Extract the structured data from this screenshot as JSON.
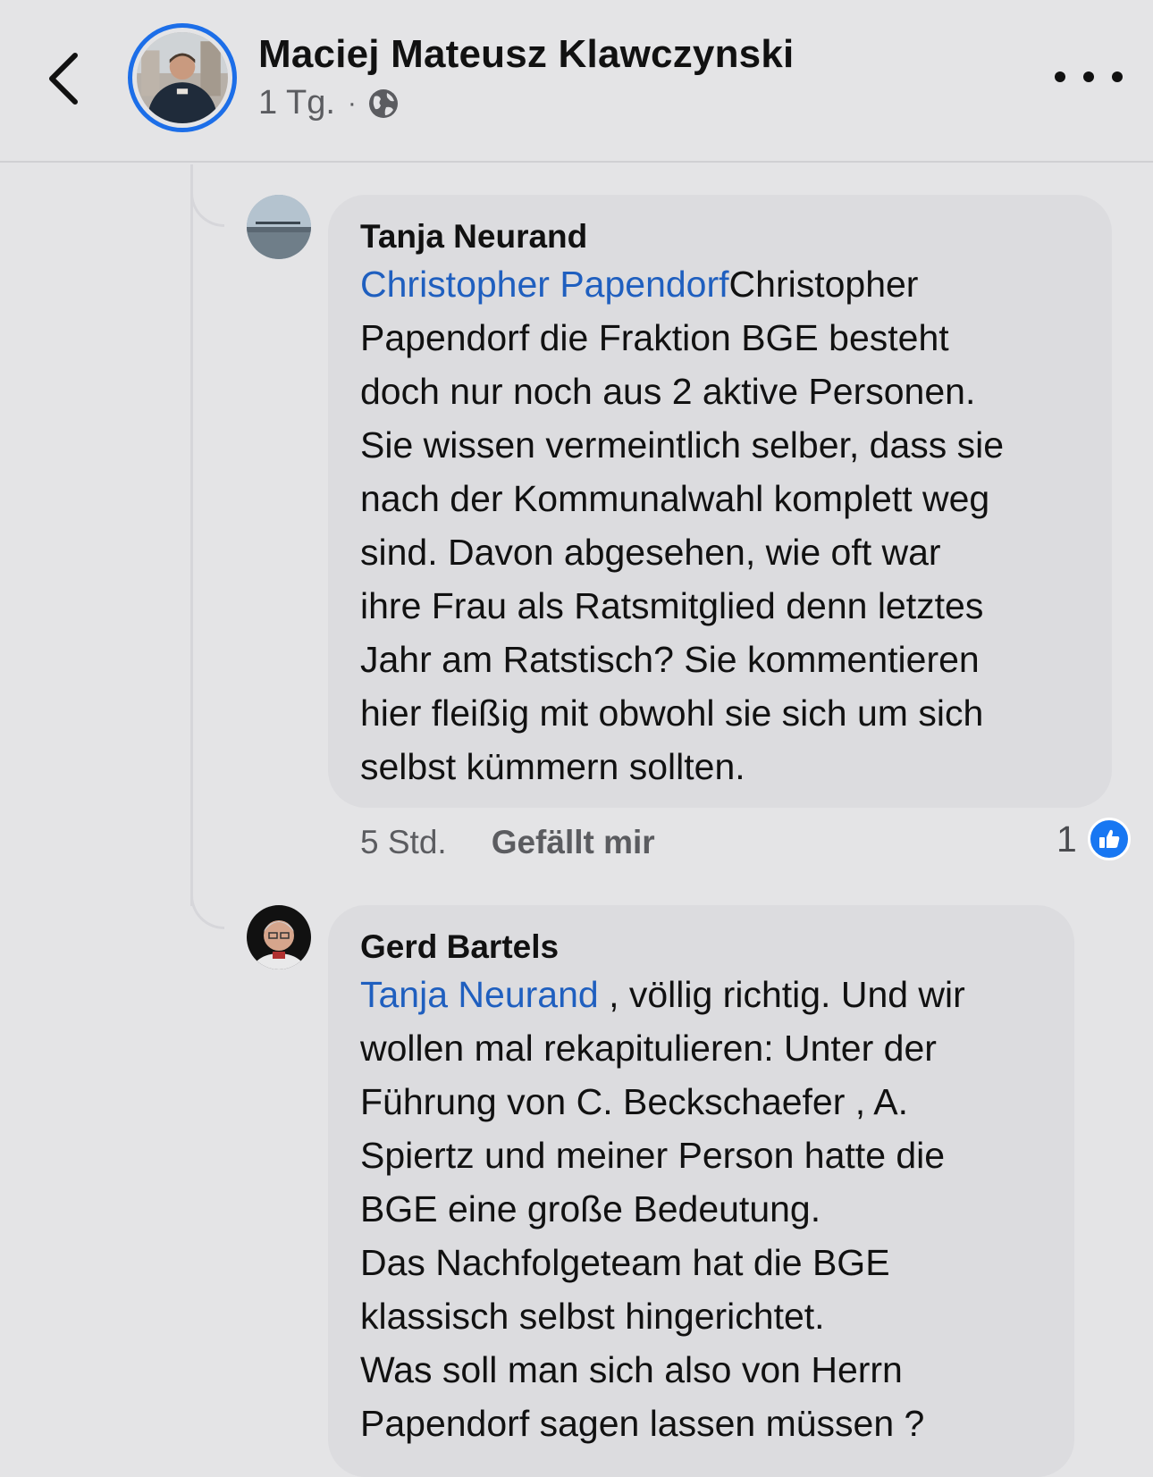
{
  "header": {
    "author": "Maciej Mateusz Klawczynski",
    "time": "1 Tg.",
    "separator": "·",
    "privacy_icon": "globe-icon",
    "back_icon": "chevron-left-icon",
    "more_icon": "more-dots-icon"
  },
  "comments": [
    {
      "name": "Tanja Neurand",
      "mention": "Christopher Papendorf",
      "text_lines": [
        "Christopher",
        "Papendorf die Fraktion BGE besteht",
        "doch nur noch aus 2 aktive Personen.",
        "Sie wissen vermeintlich selber, dass sie",
        "nach der Kommunalwahl komplett weg",
        "sind. Davon abgesehen, wie oft war",
        "ihre Frau als Ratsmitglied denn letztes",
        "Jahr am Ratstisch? Sie kommentieren",
        "hier fleißig mit obwohl sie sich um sich",
        "selbst kümmern sollten."
      ],
      "time": "5 Std.",
      "like_label": "Gefällt mir",
      "reaction_count": "1",
      "reaction_icon": "thumbs-up-icon"
    },
    {
      "name": "Gerd Bartels",
      "mention": "Tanja Neurand",
      "text_lines": [
        " , völlig richtig. Und wir",
        "wollen mal rekapitulieren: Unter der",
        "Führung von C. Beckschaefer , A.",
        "Spiertz und meiner Person hatte die",
        "BGE eine große Bedeutung.",
        "Das Nachfolgeteam hat die BGE",
        "klassisch selbst hingerichtet.",
        "Was soll man sich also von Herrn",
        "Papendorf sagen lassen müssen ?"
      ]
    }
  ],
  "colors": {
    "background": "#e4e4e6",
    "bubble": "#dcdcdf",
    "mention": "#1f5fbf",
    "avatar_ring": "#1c6ee8",
    "like_blue": "#1877f2"
  }
}
